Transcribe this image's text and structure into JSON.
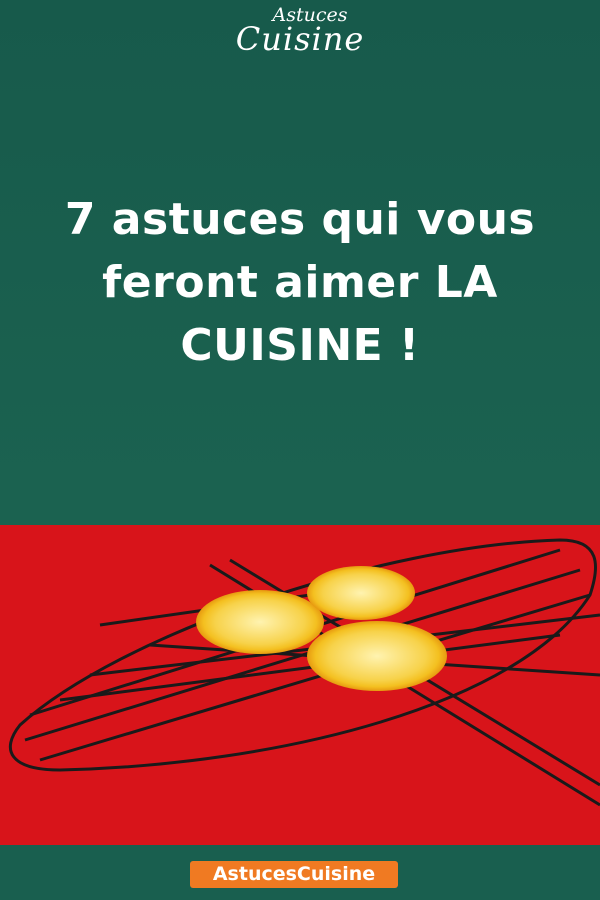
{
  "logo": {
    "line1": "Astuces",
    "line2": "Cuisine"
  },
  "title": "7 astuces qui vous feront aimer LA CUISINE !",
  "photo": {
    "subject": "lemon-slices-on-cooling-rack"
  },
  "footer": {
    "badge": "AstucesCuisine"
  },
  "colors": {
    "background": "#1b6250",
    "photo_bg": "#d8141a",
    "badge": "#f07a22"
  }
}
